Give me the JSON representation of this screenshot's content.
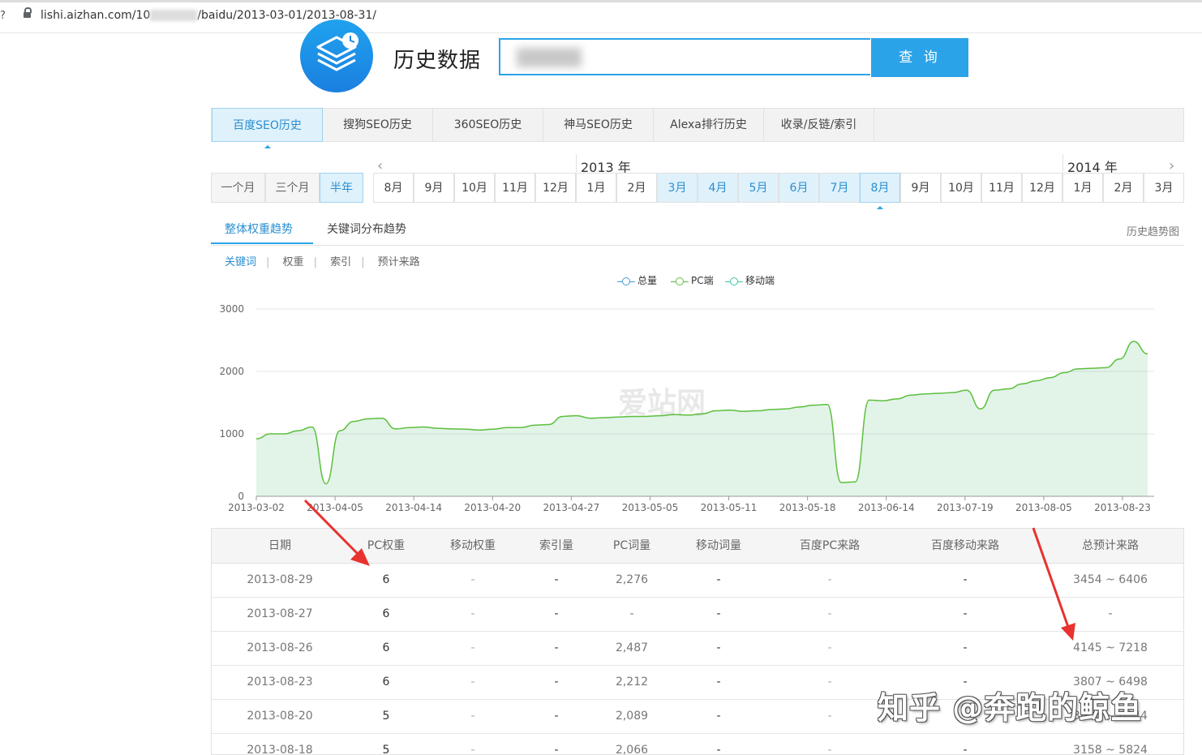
{
  "browser": {
    "edge_glyph": "?",
    "url_prefix": "lishi.aizhan.com/10",
    "url_suffix": "/baidu/2013-03-01/2013-08-31/"
  },
  "header": {
    "title": "历史数据",
    "search_button": "查 询"
  },
  "main_tabs": [
    {
      "label": "百度SEO历史",
      "active": true
    },
    {
      "label": "搜狗SEO历史"
    },
    {
      "label": "360SEO历史"
    },
    {
      "label": "神马SEO历史"
    },
    {
      "label": "Alexa排行历史"
    },
    {
      "label": "收录/反链/索引"
    }
  ],
  "ranges": [
    {
      "label": "一个月"
    },
    {
      "label": "三个月"
    },
    {
      "label": "半年",
      "active": true
    }
  ],
  "timeline": {
    "prev_icon": "‹",
    "next_icon": "›",
    "year_2013": "2013 年",
    "year_2014": "2014 年",
    "months": [
      "8月",
      "9月",
      "10月",
      "11月",
      "12月",
      "1月",
      "2月",
      "3月",
      "4月",
      "5月",
      "6月",
      "7月",
      "8月",
      "9月",
      "10月",
      "11月",
      "12月",
      "1月",
      "2月",
      "3月"
    ],
    "selected_from": 7,
    "selected_to": 12
  },
  "sub_tabs": {
    "items": [
      "整体权重趋势",
      "关键词分布趋势"
    ],
    "active": 0,
    "history_link": "历史趋势图"
  },
  "metrics": [
    "关键词",
    "权重",
    "索引",
    "预计来路"
  ],
  "metric_separator": "|",
  "legend": [
    "总量",
    "PC端",
    "移动端"
  ],
  "chart_watermark": "爱站网",
  "chart_data": {
    "type": "area",
    "y_ticks": [
      "0",
      "1000",
      "2000",
      "3000"
    ],
    "ylim": [
      0,
      3000
    ],
    "x_tick_labels": [
      "2013-03-02",
      "2013-04-05",
      "2013-04-14",
      "2013-04-20",
      "2013-04-27",
      "2013-05-05",
      "2013-05-11",
      "2013-05-18",
      "2013-06-14",
      "2013-07-19",
      "2013-08-05",
      "2013-08-23"
    ],
    "grid": true,
    "series": [
      {
        "name": "PC端",
        "color": "#5cbf3e",
        "values": [
          920,
          1000,
          1000,
          1050,
          1110,
          200,
          1050,
          1200,
          1240,
          1250,
          1080,
          1100,
          1110,
          1090,
          1080,
          1075,
          1060,
          1075,
          1100,
          1100,
          1140,
          1150,
          1280,
          1290,
          1250,
          1260,
          1270,
          1280,
          1280,
          1290,
          1310,
          1300,
          1320,
          1370,
          1380,
          1360,
          1370,
          1390,
          1400,
          1430,
          1460,
          1470,
          220,
          230,
          1540,
          1530,
          1560,
          1620,
          1640,
          1650,
          1660,
          1700,
          1400,
          1700,
          1720,
          1800,
          1850,
          1900,
          1980,
          2040,
          2050,
          2060,
          2200,
          2480,
          2280
        ]
      }
    ]
  },
  "table": {
    "headers": [
      "日期",
      "PC权重",
      "移动权重",
      "索引量",
      "PC词量",
      "移动词量",
      "百度PC来路",
      "百度移动来路",
      "总预计来路"
    ],
    "rows": [
      [
        "2013-08-29",
        "6",
        "-",
        "-",
        "2,276",
        "-",
        "-",
        "-",
        "3454 ~ 6406"
      ],
      [
        "2013-08-27",
        "6",
        "-",
        "-",
        "-",
        "-",
        "-",
        "-",
        "-"
      ],
      [
        "2013-08-26",
        "6",
        "-",
        "-",
        "2,487",
        "-",
        "-",
        "-",
        "4145 ~ 7218"
      ],
      [
        "2013-08-23",
        "6",
        "-",
        "-",
        "2,212",
        "-",
        "-",
        "-",
        "3807 ~ 6498"
      ],
      [
        "2013-08-20",
        "5",
        "-",
        "-",
        "2,089",
        "-",
        "-",
        "-",
        "3646 ~ 6344"
      ],
      [
        "2013-08-18",
        "5",
        "-",
        "-",
        "2,066",
        "-",
        "-",
        "-",
        "3158 ~ 5824"
      ]
    ]
  },
  "watermark": "知乎 @奔跑的鲸鱼"
}
